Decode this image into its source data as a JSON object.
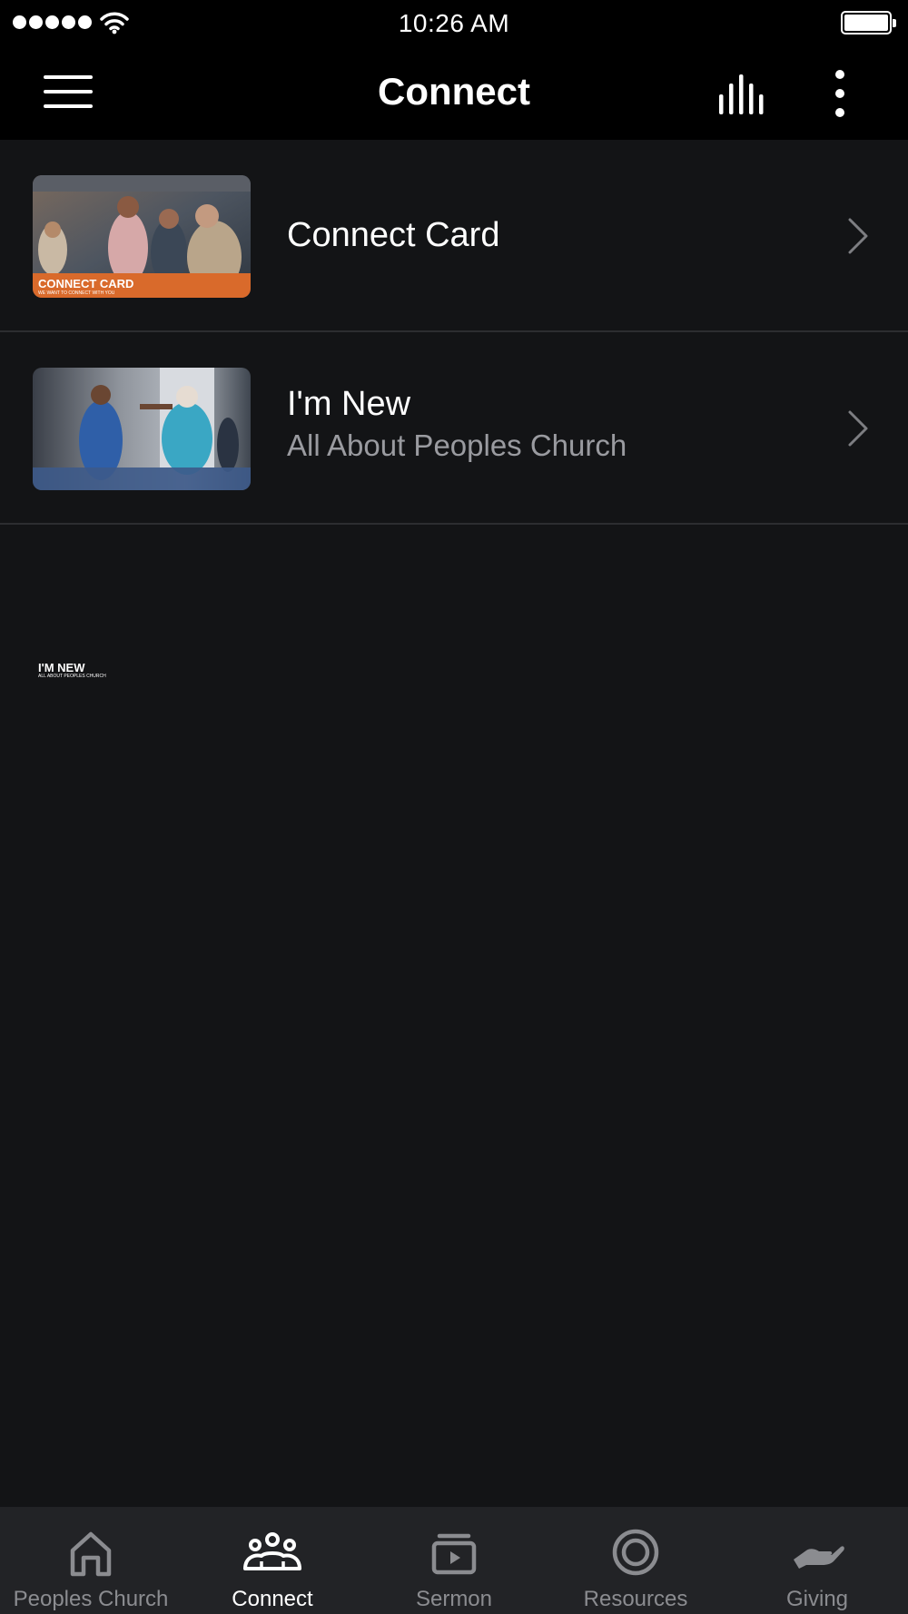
{
  "status_bar": {
    "time": "10:26 AM"
  },
  "nav": {
    "title": "Connect",
    "menu_icon": "hamburger-icon",
    "audio_icon": "audio-bars-icon",
    "more_icon": "more-vertical-icon"
  },
  "list": {
    "items": [
      {
        "title": "Connect Card",
        "subtitle": "",
        "thumb_caption": "CONNECT CARD",
        "thumb_tagline": "WE WANT TO CONNECT WITH YOU",
        "thumb_band_color": "#d96a2b"
      },
      {
        "title": "I'm New",
        "subtitle": "All About Peoples Church",
        "thumb_caption": "I'M NEW",
        "thumb_tagline": "ALL ABOUT PEOPLES CHURCH",
        "thumb_band_color": "#3d5a8a"
      }
    ]
  },
  "tabs": {
    "items": [
      {
        "label": "Peoples Church",
        "icon": "home-icon",
        "active": false
      },
      {
        "label": "Connect",
        "icon": "group-icon",
        "active": true
      },
      {
        "label": "Sermon",
        "icon": "video-play-icon",
        "active": false
      },
      {
        "label": "Resources",
        "icon": "target-ring-icon",
        "active": false
      },
      {
        "label": "Giving",
        "icon": "giving-hand-icon",
        "active": false
      }
    ]
  },
  "colors": {
    "background": "#131416",
    "header": "#000000",
    "tab_bar": "#222326",
    "active_tab": "#ffffff",
    "inactive_tab": "#8b8c90",
    "divider": "#2c2d30",
    "subtitle": "#9a9ba0"
  }
}
